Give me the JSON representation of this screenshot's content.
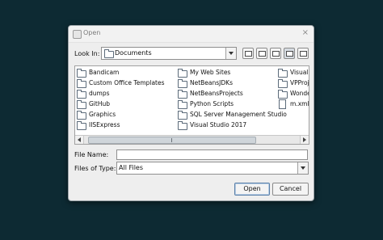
{
  "dialog": {
    "title": "Open",
    "close_symbol": "×"
  },
  "look_in": {
    "label": "Look In:",
    "mnemonic": "I",
    "value": "Documents"
  },
  "toolbar": [
    "up-one-level-icon",
    "home-icon",
    "new-folder-icon",
    "list-view-icon",
    "details-view-icon"
  ],
  "files": [
    {
      "name": "Bandicam",
      "type": "folder"
    },
    {
      "name": "Custom Office Templates",
      "type": "folder"
    },
    {
      "name": "dumps",
      "type": "folder"
    },
    {
      "name": "GitHub",
      "type": "folder"
    },
    {
      "name": "Graphics",
      "type": "folder"
    },
    {
      "name": "IISExpress",
      "type": "folder"
    },
    {
      "name": "My Web Sites",
      "type": "folder"
    },
    {
      "name": "NetBeansJDKs",
      "type": "folder"
    },
    {
      "name": "NetBeansProjects",
      "type": "folder"
    },
    {
      "name": "Python Scripts",
      "type": "folder"
    },
    {
      "name": "SQL Server Management Studio",
      "type": "folder"
    },
    {
      "name": "Visual Studio 2017",
      "type": "folder"
    },
    {
      "name": "Visual S",
      "type": "folder"
    },
    {
      "name": "VPProje",
      "type": "folder"
    },
    {
      "name": "Wonder",
      "type": "folder"
    },
    {
      "name": "m.xml",
      "type": "file"
    }
  ],
  "file_name": {
    "label": "File Name:",
    "value": ""
  },
  "files_of_type": {
    "label": "Files of Type:",
    "value": "All Files"
  },
  "buttons": {
    "open": "Open",
    "cancel": "Cancel"
  }
}
